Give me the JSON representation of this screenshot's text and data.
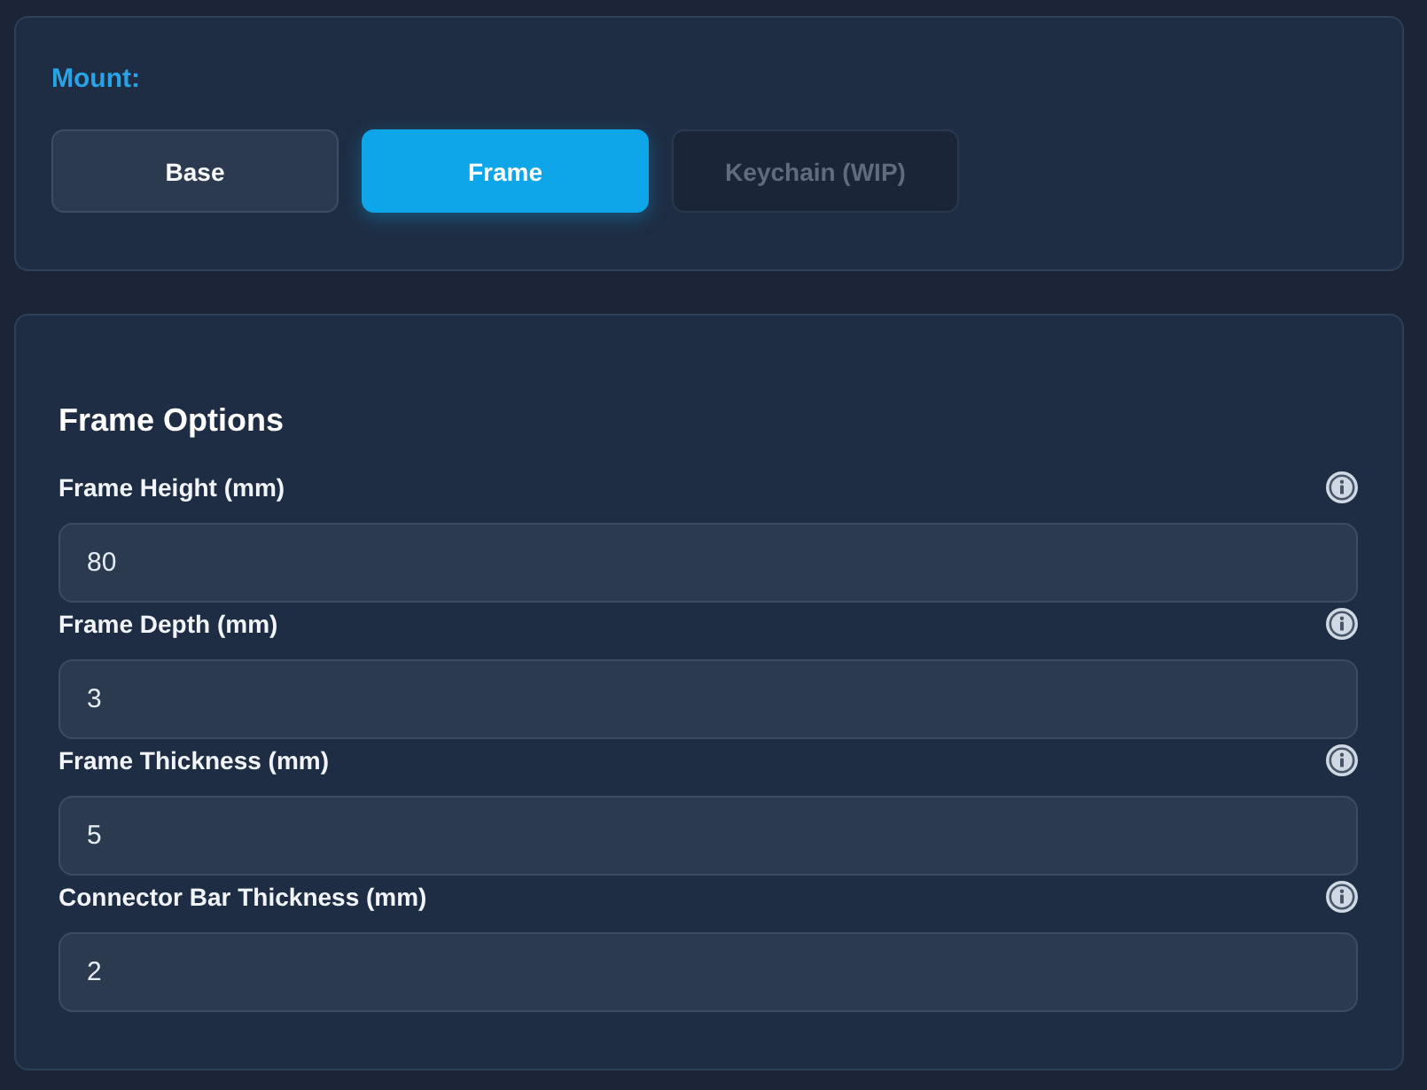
{
  "mount": {
    "label": "Mount:",
    "options": [
      {
        "label": "Base",
        "selected": false,
        "disabled": false
      },
      {
        "label": "Frame",
        "selected": true,
        "disabled": false
      },
      {
        "label": "Keychain (WIP)",
        "selected": false,
        "disabled": true
      }
    ]
  },
  "options_panel": {
    "title": "Frame Options",
    "fields": [
      {
        "label": "Frame Height (mm)",
        "value": "80"
      },
      {
        "label": "Frame Depth (mm)",
        "value": "3"
      },
      {
        "label": "Frame Thickness (mm)",
        "value": "5"
      },
      {
        "label": "Connector Bar Thickness (mm)",
        "value": "2"
      }
    ]
  }
}
